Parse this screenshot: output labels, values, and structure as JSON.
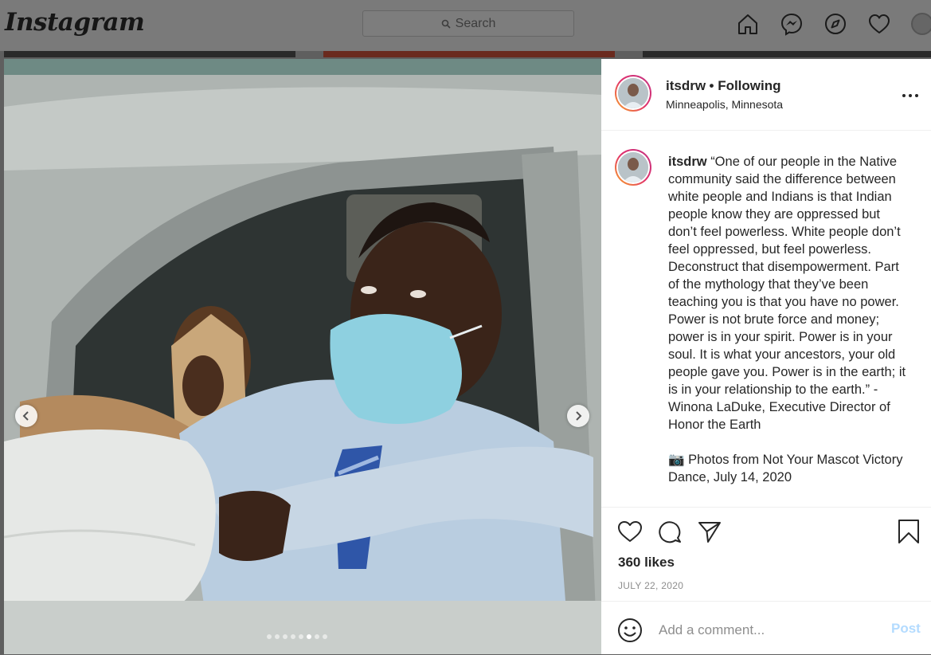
{
  "app": {
    "logo": "Instagram"
  },
  "search": {
    "label": "Search"
  },
  "nav": {
    "icons": [
      "home-icon",
      "messenger-icon",
      "explore-icon",
      "heart-icon",
      "profile-avatar"
    ]
  },
  "post": {
    "username": "itsdrw",
    "following": "• Following",
    "location": "Minneapolis, Minnesota",
    "caption_user": "itsdrw",
    "caption_text": "“One of our people in the Native community said the difference between white people and Indians is that Indian people know they are oppressed but don’t feel powerless. White people don’t feel oppressed, but feel powerless. Deconstruct that disempowerment. Part of the mythology that they’ve been teaching you is that you have no power. Power is not brute force and money; power is in your spirit. Power is in your soul. It is what your ancestors, your old people gave you. Power is in the earth; it is in your relationship to the earth.” -Winona LaDuke, Executive Director of Honor the Earth",
    "photo_credit": "📷 Photos from Not Your Mascot Victory Dance, July 14, 2020",
    "likes": "360 likes",
    "date": "JULY 22, 2020",
    "carousel": {
      "total": 8,
      "active_index": 5
    }
  },
  "comment": {
    "placeholder": "Add a comment...",
    "post_label": "Post"
  },
  "colors": {
    "accent": "#0095f6",
    "post_disabled": "#b3dbff",
    "text": "#262626",
    "muted": "#8e8e8e"
  }
}
